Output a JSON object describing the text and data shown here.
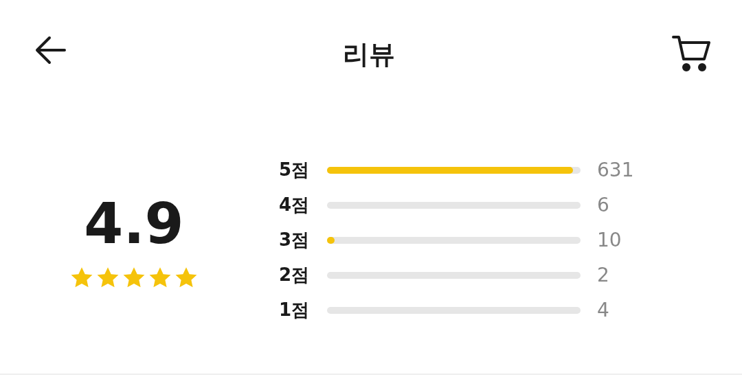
{
  "header": {
    "title": "리뷰"
  },
  "summary": {
    "score": "4.9",
    "stars": 5
  },
  "distribution": [
    {
      "label": "5점",
      "level": 0.97,
      "count": "631"
    },
    {
      "label": "4점",
      "count": "6"
    },
    {
      "label": "3점",
      "level": 0.03,
      "count": "10"
    },
    {
      "label": "2점",
      "count": "2"
    },
    {
      "label": "1점",
      "count": "4"
    }
  ]
}
